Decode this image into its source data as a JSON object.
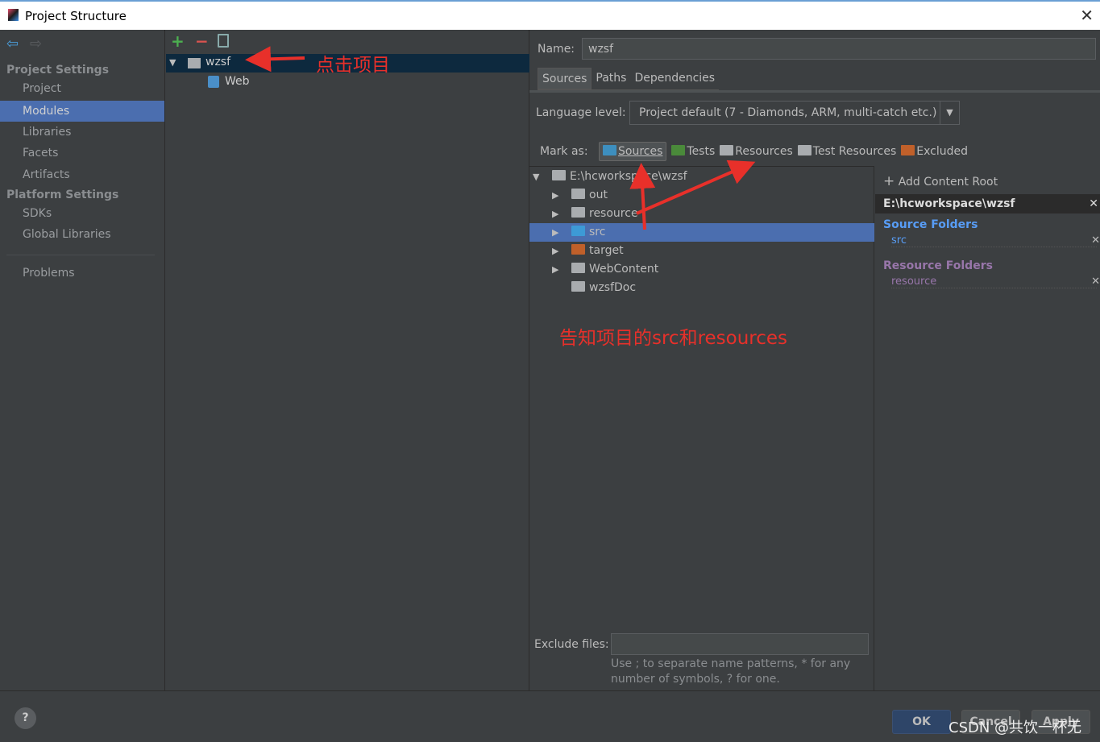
{
  "window": {
    "title": "Project Structure"
  },
  "sidebar": {
    "project_settings": "Project Settings",
    "platform_settings": "Platform Settings",
    "items": [
      {
        "label": "Project"
      },
      {
        "label": "Modules"
      },
      {
        "label": "Libraries"
      },
      {
        "label": "Facets"
      },
      {
        "label": "Artifacts"
      },
      {
        "label": "SDKs"
      },
      {
        "label": "Global Libraries"
      },
      {
        "label": "Problems"
      }
    ],
    "selected": "Modules"
  },
  "modules_tree": [
    {
      "label": "wzsf"
    },
    {
      "label": "Web"
    }
  ],
  "module": {
    "name_label": "Name:",
    "name_value": "wzsf",
    "tabs": [
      {
        "label": "Sources"
      },
      {
        "label": "Paths"
      },
      {
        "label": "Dependencies"
      }
    ],
    "language_label": "Language level:",
    "language_value": "Project default (7 - Diamonds, ARM, multi-catch etc.)",
    "mark_as_label": "Mark as:",
    "mark_as": [
      {
        "label": "Sources",
        "color": "#3d8fbf"
      },
      {
        "label": "Tests",
        "color": "#4a8a3a"
      },
      {
        "label": "Resources",
        "color": "#a9acaf"
      },
      {
        "label": "Test Resources",
        "color": "#a9acaf"
      },
      {
        "label": "Excluded",
        "color": "#c0602a"
      }
    ],
    "content_tree": {
      "root": "E:\\hcworkspace\\wzsf",
      "children": [
        {
          "label": "out",
          "color": "#a9acaf"
        },
        {
          "label": "resource",
          "color": "#a9acaf"
        },
        {
          "label": "src",
          "color": "#3d9ad6"
        },
        {
          "label": "target",
          "color": "#c0602a"
        },
        {
          "label": "WebContent",
          "color": "#a9acaf"
        },
        {
          "label": "wzsfDoc",
          "color": "#a9acaf"
        }
      ],
      "selected": "src"
    },
    "add_content_root": "Add Content Root",
    "content_root_path": "E:\\hcworkspace\\wzsf",
    "source_folders_title": "Source Folders",
    "source_folders": [
      "src"
    ],
    "resource_folders_title": "Resource Folders",
    "resource_folders": [
      "resource"
    ],
    "exclude_label": "Exclude files:",
    "exclude_value": "",
    "exclude_hint_1": "Use ; to separate name patterns, * for any",
    "exclude_hint_2": "number of symbols, ? for one."
  },
  "annotations": {
    "click_project": "点击项目",
    "tell_src": "告知项目的src和resources"
  },
  "buttons": {
    "ok": "OK",
    "cancel": "Cancel",
    "apply": "Apply"
  },
  "watermark": "CSDN @共饮一杯无",
  "colors": {
    "selection": "#4b6eaf",
    "annotation": "#e8302a",
    "source_title": "#589df6",
    "resource_title": "#9876aa"
  }
}
